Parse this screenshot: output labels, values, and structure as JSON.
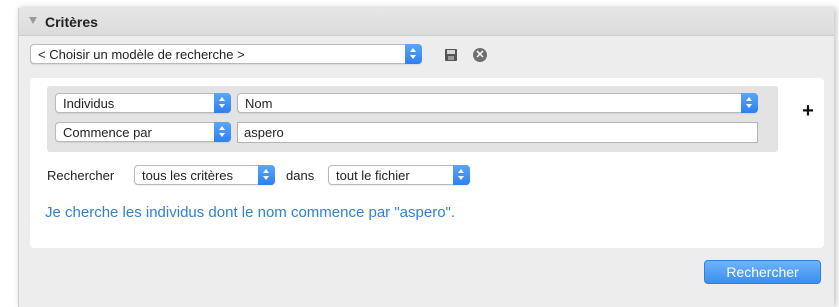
{
  "panel": {
    "title": "Critères"
  },
  "model_select": {
    "value": "< Choisir un modèle de recherche >"
  },
  "criteria": {
    "field": "Individus",
    "subfield": "Nom",
    "operator": "Commence par",
    "value": "aspero"
  },
  "search_row": {
    "label": "Rechercher",
    "scope": "tous les critères",
    "in_label": "dans",
    "file": "tout le fichier"
  },
  "summary": "Je cherche les individus dont le nom commence par \"aspero\".",
  "buttons": {
    "search": "Rechercher",
    "add": "+",
    "delete": "✕"
  },
  "icons": {
    "collapse": "triangle-down-icon",
    "save": "save-icon",
    "delete": "close-circle-icon",
    "add": "plus-icon",
    "dropdown": "chevron-updown-icon"
  },
  "colors": {
    "accent": "#3a8ff0",
    "summary_text": "#2f80d8",
    "panel_bg": "#ededed"
  }
}
